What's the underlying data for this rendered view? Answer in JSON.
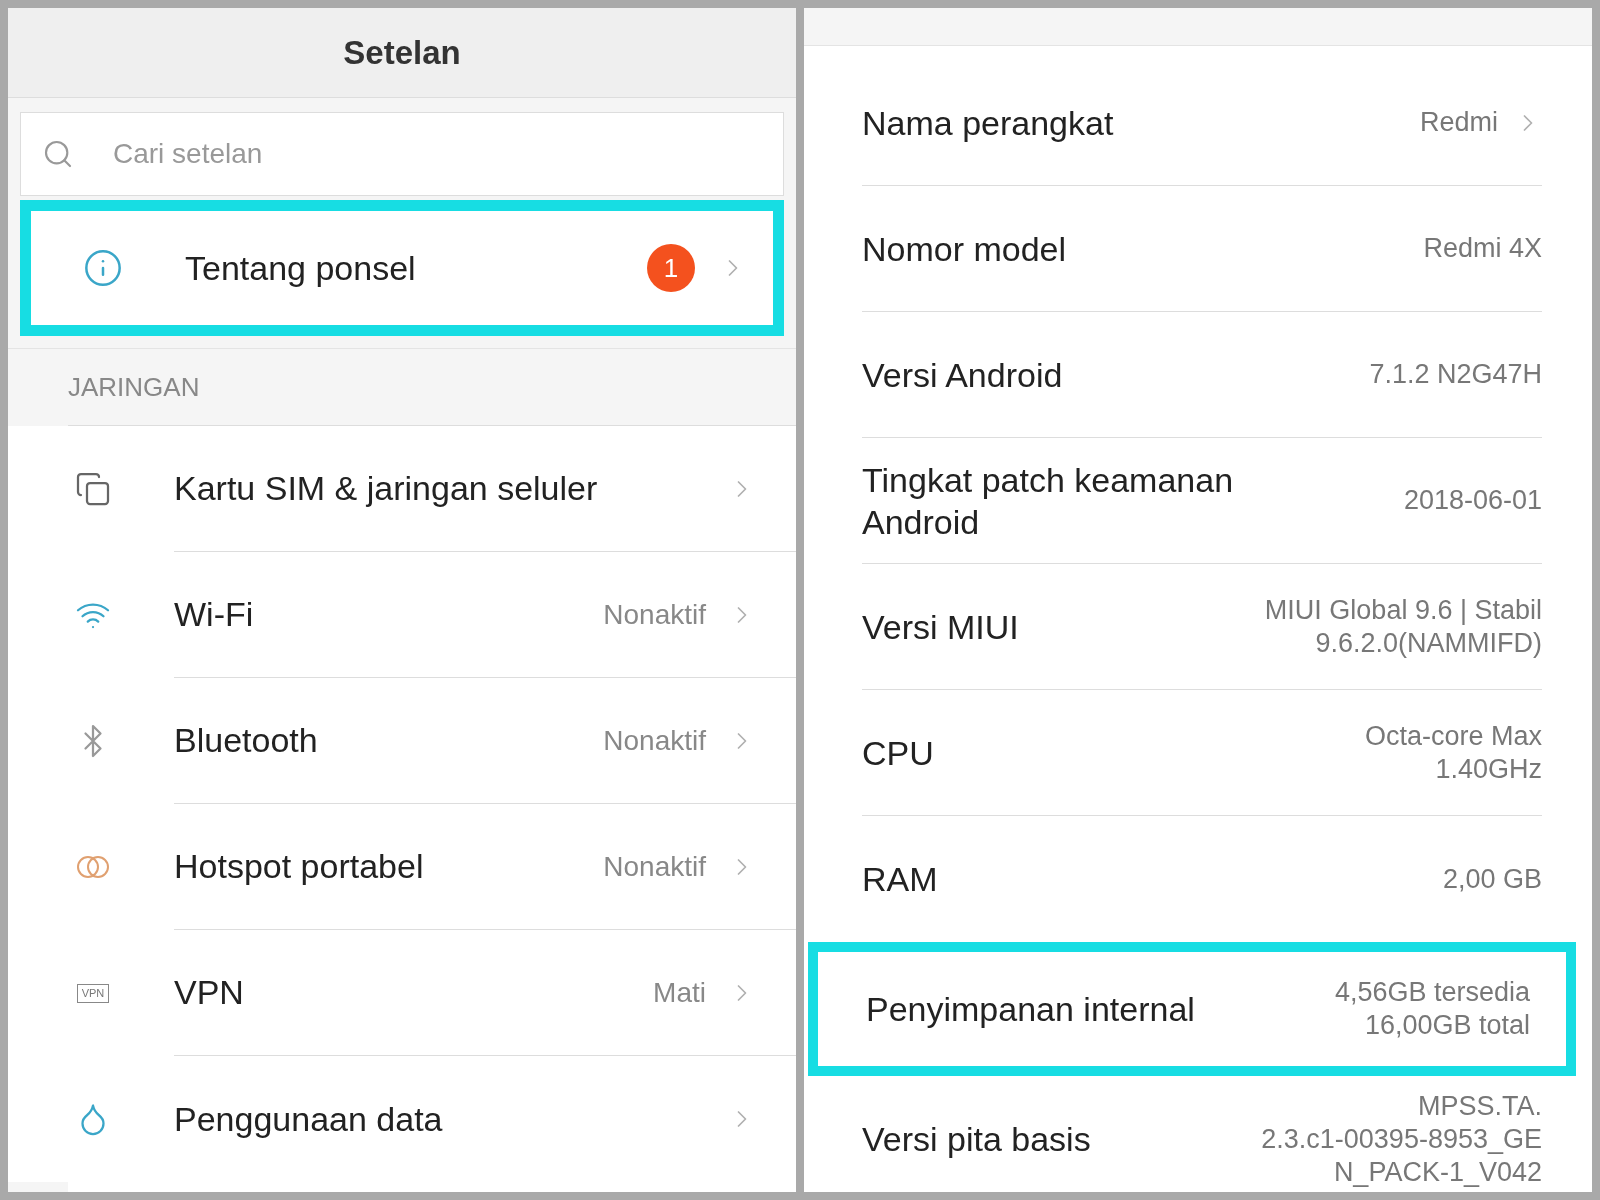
{
  "left": {
    "title": "Setelan",
    "search": {
      "placeholder": "Cari setelan"
    },
    "top_item": {
      "label": "Tentang ponsel",
      "badge": "1",
      "highlighted": true
    },
    "section": "JARINGAN",
    "items": [
      {
        "label": "Kartu SIM & jaringan seluler"
      },
      {
        "label": "Wi-Fi",
        "value": "Nonaktif"
      },
      {
        "label": "Bluetooth",
        "value": "Nonaktif"
      },
      {
        "label": "Hotspot portabel",
        "value": "Nonaktif"
      },
      {
        "label": "VPN",
        "value": "Mati",
        "icon_text": "VPN"
      },
      {
        "label": "Penggunaan data"
      }
    ]
  },
  "right": {
    "rows": [
      {
        "kind": "link",
        "label": "Nama perangkat",
        "value": [
          "Redmi"
        ]
      },
      {
        "kind": "plain",
        "label": "Nomor model",
        "value": [
          "Redmi 4X"
        ]
      },
      {
        "kind": "plain",
        "label": "Versi Android",
        "value": [
          "7.1.2 N2G47H"
        ]
      },
      {
        "kind": "plain",
        "label": "Tingkat patch keamanan Android",
        "value": [
          "2018-06-01"
        ]
      },
      {
        "kind": "plain",
        "label": "Versi MIUI",
        "value": [
          "MIUI Global 9.6 | Stabil",
          "9.6.2.0(NAMMIFD)"
        ]
      },
      {
        "kind": "plain",
        "label": "CPU",
        "value": [
          "Octa-core Max",
          "1.40GHz"
        ]
      },
      {
        "kind": "plain",
        "label": "RAM",
        "value": [
          "2,00 GB"
        ]
      },
      {
        "kind": "highlighted",
        "label": "Penyimpanan internal",
        "value": [
          "4,56GB tersedia",
          "16,00GB total"
        ]
      },
      {
        "kind": "plain",
        "label": "Versi pita basis",
        "value": [
          "MPSS.TA.",
          "2.3.c1-00395-8953_GE",
          "N_PACK-1_V042"
        ]
      }
    ]
  }
}
